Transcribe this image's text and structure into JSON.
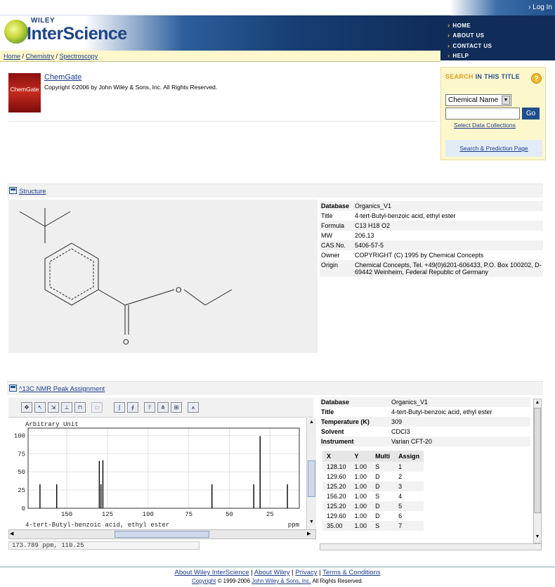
{
  "header": {
    "login": "Log In",
    "brand_small": "WILEY",
    "brand_big": "InterScience",
    "nav": [
      "HOME",
      "ABOUT US",
      "CONTACT US",
      "HELP"
    ]
  },
  "breadcrumb": [
    "Home",
    "Chemistry",
    "Spectroscopy"
  ],
  "chemgate": {
    "logo_text": "ChemGate",
    "title": "ChemGate",
    "copyright": "Copyright ©2006 by John Wiley & Sons, Inc. All Rights Reserved."
  },
  "search": {
    "title_a": "SEARCH",
    "title_b": "IN THIS TITLE",
    "help": "?",
    "select_value": "Chemical Name",
    "input_value": "",
    "go": "Go",
    "select_collections": "Select Data Collections",
    "prediction": "Search & Prediction Page"
  },
  "structure": {
    "section_title": "Structure",
    "fields": [
      {
        "k": "Database",
        "v": "Organics_V1",
        "bold": true
      },
      {
        "k": "Title",
        "v": "4-tert-Butyl-benzoic acid, ethyl ester"
      },
      {
        "k": "Formula",
        "v": "C13 H18 O2"
      },
      {
        "k": "MW",
        "v": "206.13"
      },
      {
        "k": "CAS No.",
        "v": "5406-57-5"
      },
      {
        "k": "Owner",
        "v": "COPYRIGHT (C) 1995 by Chemical Concepts"
      },
      {
        "k": "Origin",
        "v": "Chemical Concepts, Tel. +49(0)6201-606433, P.O. Box 100202, D-69442 Weinheim, Federal Republic of Germany"
      }
    ],
    "atom_label": "O"
  },
  "nmr": {
    "section_title": "^13C NMR Peak Assignment",
    "ylabel": "Arbitrary Unit",
    "xunit": "ppm",
    "compound": "4-tert-Butyl-benzoic acid, ethyl ester",
    "coord": "173.789 ppm, 110.25",
    "fields": [
      {
        "k": "Database",
        "v": "Organics_V1",
        "bold": true
      },
      {
        "k": "Title",
        "v": "4-tert-Butyl-benzoic acid, ethyl ester"
      },
      {
        "k": "Temperature (K)",
        "v": "309"
      },
      {
        "k": "Solvent",
        "v": "CDCl3"
      },
      {
        "k": "Instrument",
        "v": "Varian CFT-20"
      }
    ],
    "peak_headers": [
      "X",
      "Y",
      "Multi",
      "Assign"
    ],
    "peaks": [
      [
        "128.10",
        "1.00",
        "S",
        "1"
      ],
      [
        "129.60",
        "1.00",
        "D",
        "2"
      ],
      [
        "125.20",
        "1.00",
        "D",
        "3"
      ],
      [
        "156.20",
        "1.00",
        "S",
        "4"
      ],
      [
        "125.20",
        "1.00",
        "D",
        "5"
      ],
      [
        "129.60",
        "1.00",
        "D",
        "6"
      ],
      [
        "35.00",
        "1.00",
        "S",
        "7"
      ]
    ]
  },
  "chart_data": {
    "type": "bar",
    "ylabel": "Arbitrary Unit",
    "xlabel": "ppm",
    "title": "4-tert-Butyl-benzoic acid, ethyl ester",
    "xlim": [
      173.8,
      7
    ],
    "ylim": [
      0,
      110
    ],
    "xticks": [
      150,
      125,
      100,
      75,
      50,
      25
    ],
    "yticks": [
      0,
      25,
      50,
      75,
      100
    ],
    "peaks": [
      {
        "x": 166.5,
        "y": 33
      },
      {
        "x": 156.2,
        "y": 33
      },
      {
        "x": 130.0,
        "y": 65
      },
      {
        "x": 129.0,
        "y": 33
      },
      {
        "x": 127.8,
        "y": 66
      },
      {
        "x": 60.7,
        "y": 33
      },
      {
        "x": 35.0,
        "y": 33
      },
      {
        "x": 31.1,
        "y": 99
      },
      {
        "x": 14.3,
        "y": 33
      }
    ]
  },
  "footer": {
    "links": [
      "About Wiley InterScience",
      "About Wiley",
      "Privacy",
      "Terms & Conditions"
    ],
    "copyright_prefix": "Copyright",
    "copyright_years": "© 1999-2006",
    "copyright_owner": "John Wiley & Sons, Inc.",
    "copyright_suffix": "All Rights Reserved."
  }
}
